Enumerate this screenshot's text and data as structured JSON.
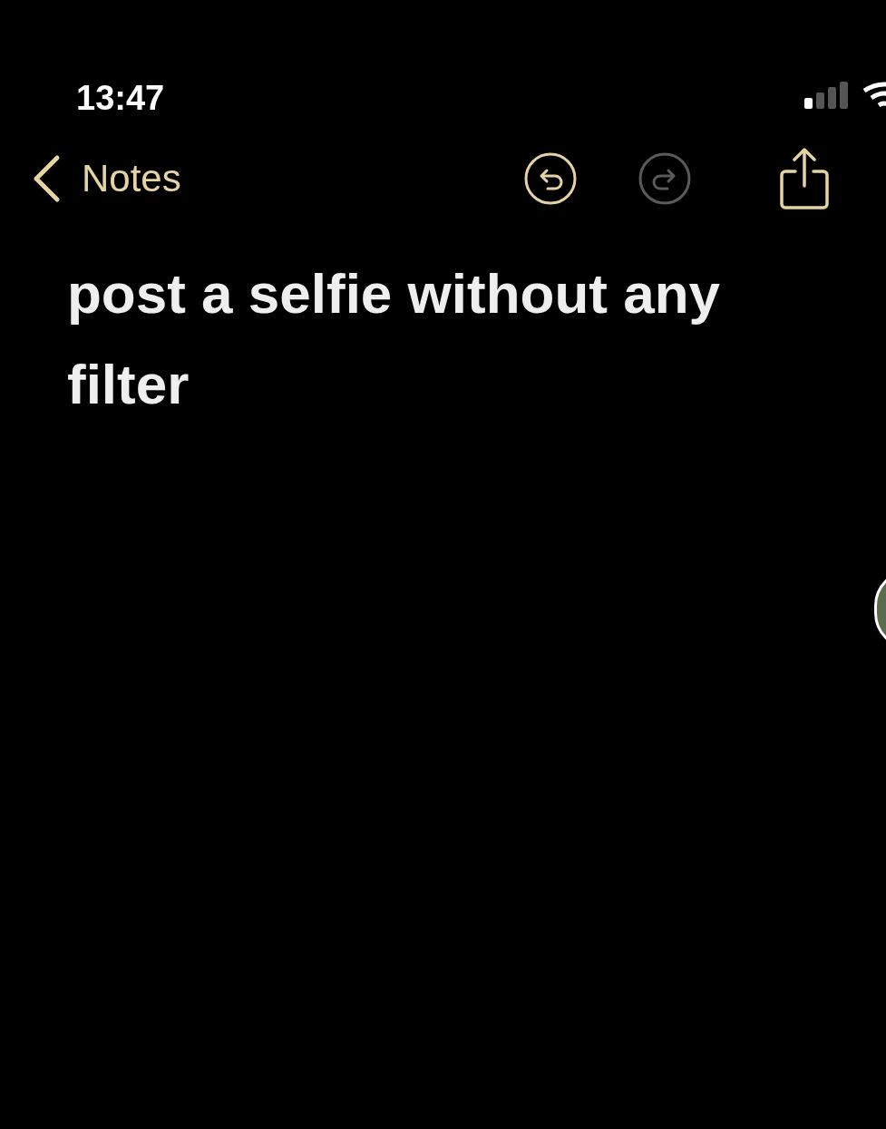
{
  "status_bar": {
    "time": "13:47"
  },
  "nav": {
    "back_label": "Notes",
    "undo": {
      "disabled": false
    },
    "redo": {
      "disabled": true
    }
  },
  "note": {
    "text": "post a selfie without any filter"
  }
}
